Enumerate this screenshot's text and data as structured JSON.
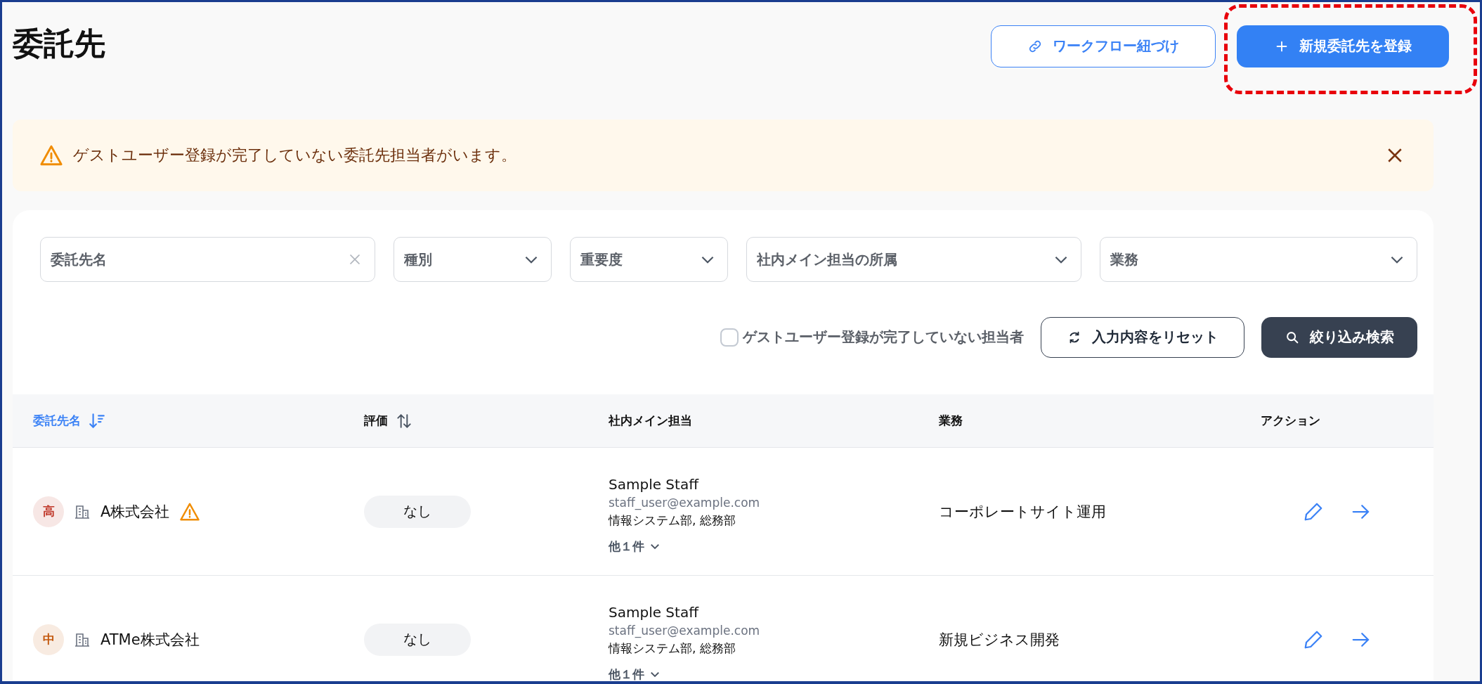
{
  "page": {
    "title": "委託先"
  },
  "header_buttons": [
    {
      "kind": "outline",
      "label": "ワークフロー紐づけ"
    },
    {
      "kind": "primary",
      "label": "新規委託先を登録"
    }
  ],
  "alert": {
    "message": "ゲストユーザー登録が完了していない委託先担当者がいます。"
  },
  "filters": [
    {
      "kind": "text",
      "placeholder": "委託先名"
    },
    {
      "kind": "select",
      "placeholder": "種別"
    },
    {
      "kind": "select",
      "placeholder": "重要度"
    },
    {
      "kind": "select",
      "placeholder": "社内メイン担当の所属"
    },
    {
      "kind": "select",
      "placeholder": "業務"
    }
  ],
  "guest_filter": {
    "label": "ゲストユーザー登録が完了していない担当者",
    "checked": false
  },
  "reset_button": {
    "label": "入力内容をリセット"
  },
  "search_button": {
    "label": "絞り込み検索"
  },
  "table": {
    "columns": [
      {
        "label": "委託先名",
        "sortable": true,
        "selected": true
      },
      {
        "label": "評価",
        "sortable": true,
        "selected": false
      },
      {
        "label": "社内メイン担当"
      },
      {
        "label": "業務"
      },
      {
        "label": "アクション"
      }
    ],
    "rows": [
      {
        "priority": "高",
        "color": "#c0392b",
        "name": "A株式会社",
        "warning": true,
        "rating": "なし",
        "staff_name": "Sample Staff",
        "staff_email": "staff_user@example.com",
        "staff_department": "情報システム部, 総務部",
        "more": "他１件",
        "expanded": false,
        "business": "コーポレートサイト運用"
      },
      {
        "priority": "中",
        "color": "#c2570c",
        "name": "ATMe株式会社",
        "warning": false,
        "rating": "なし",
        "staff_name": "Sample Staff",
        "staff_email": "staff_user@example.com",
        "staff_department": "情報システム部, 総務部",
        "more": "他１件",
        "expanded": false,
        "business": "新規ビジネス開発"
      }
    ]
  }
}
